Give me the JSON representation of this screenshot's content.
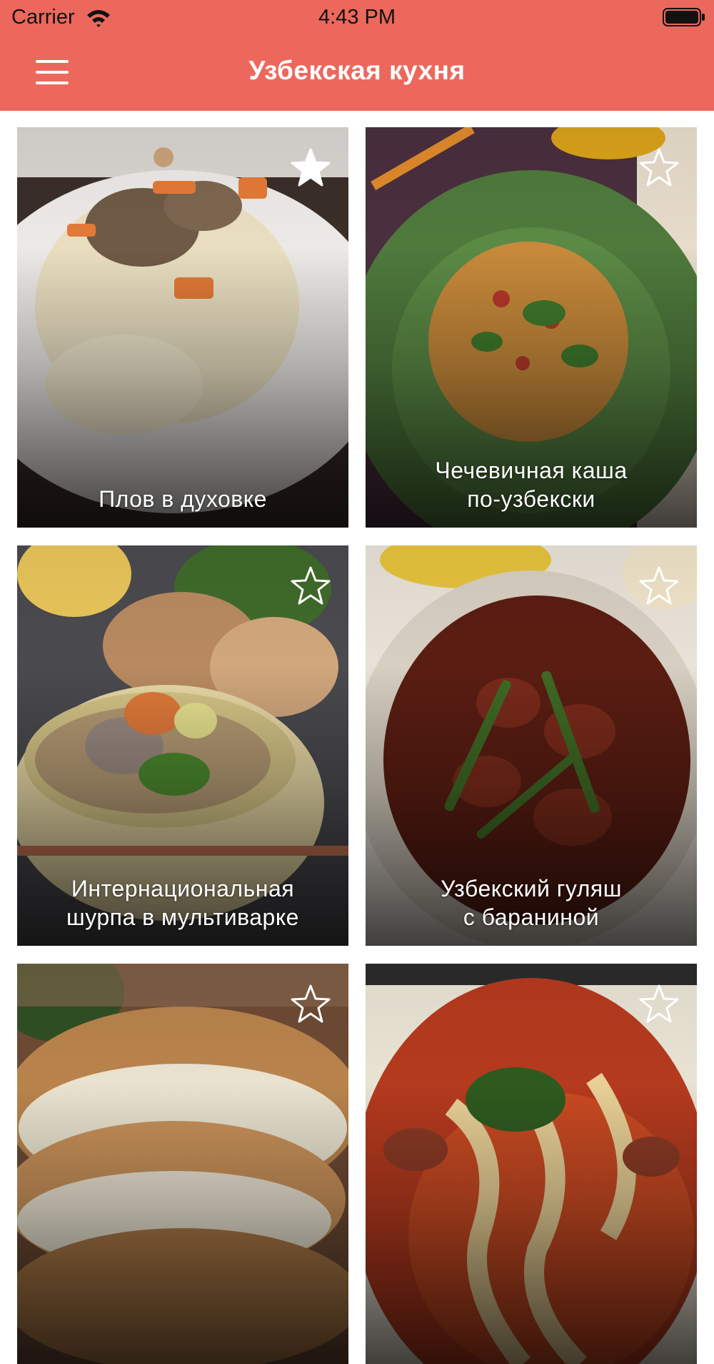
{
  "status_bar": {
    "carrier": "Carrier",
    "time": "4:43 PM",
    "wifi_icon": "wifi-icon",
    "battery_icon": "battery-icon"
  },
  "header": {
    "title": "Узбекская кухня",
    "menu_icon": "hamburger-menu-icon",
    "color": "#ec685c"
  },
  "recipes": [
    {
      "title": "Плов в духовке",
      "favorite": true
    },
    {
      "title": "Чечевичная каша\nпо-узбекски",
      "favorite": false
    },
    {
      "title": "Интернациональная\nшурпа в мультиварке",
      "favorite": false
    },
    {
      "title": "Узбекский гуляш\nс бараниной",
      "favorite": false
    },
    {
      "title": "",
      "favorite": false
    },
    {
      "title": "",
      "favorite": false
    }
  ]
}
